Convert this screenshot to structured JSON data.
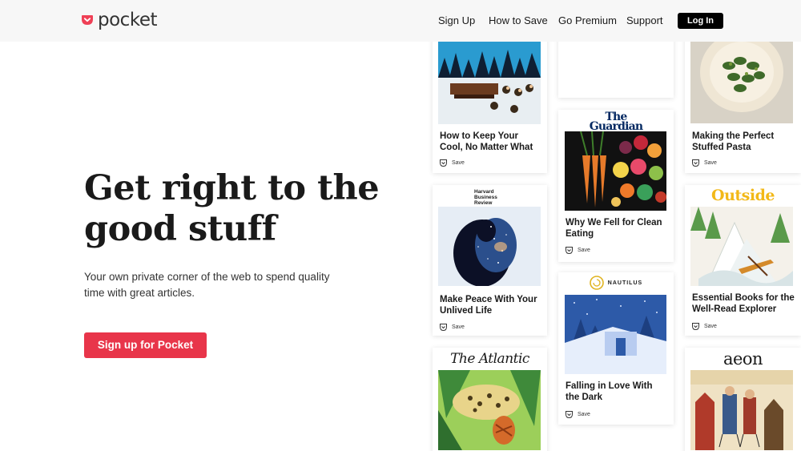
{
  "header": {
    "logo_text": "pocket",
    "nav": {
      "sign_up": "Sign Up",
      "how_to_save": "How to Save",
      "go_premium": "Go Premium",
      "support": "Support",
      "log_in": "Log In"
    }
  },
  "hero": {
    "headline": "Get right to the good stuff",
    "subtext": "Your own private corner of the web to spend quality time with great articles.",
    "cta": "Sign up for Pocket"
  },
  "colors": {
    "brand": "#e8354a",
    "header_bg": "#f7f7f7"
  },
  "cards": {
    "save_label": "Save",
    "keep_cool": {
      "title": "How to Keep Your Cool, No Matter What"
    },
    "stuffed_pasta": {
      "title": "Making the Perfect Stuffed Pasta"
    },
    "guardian": {
      "publisher": "The Guardian",
      "title": "Why We Fell for Clean Eating"
    },
    "hbr": {
      "publisher": "Harvard Business Review",
      "title": "Make Peace With Your Unlived Life"
    },
    "outside": {
      "publisher": "Outside",
      "title": "Essential Books for the Well-Read Explorer"
    },
    "nautilus": {
      "publisher": "NAUTILUS",
      "title": "Falling in Love With the Dark"
    },
    "atlantic": {
      "publisher": "The Atlantic"
    },
    "aeon": {
      "publisher": "aeon"
    }
  }
}
